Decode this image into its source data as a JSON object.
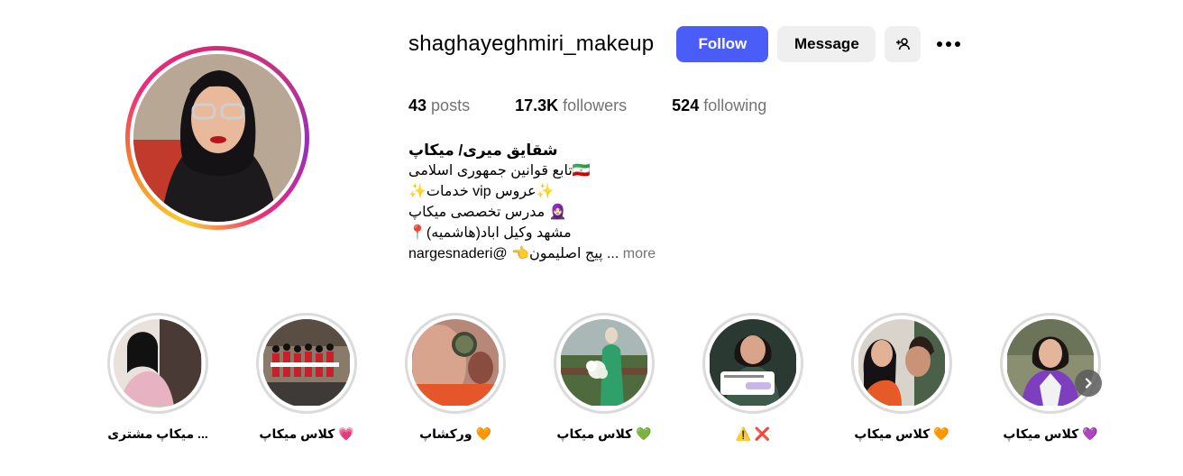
{
  "profile": {
    "username": "shaghayeghmiri_makeup",
    "follow_label": "Follow",
    "message_label": "Message",
    "icons": {
      "add_user": "add-user-icon",
      "more": "more-options-icon"
    },
    "accent": "#4a5df9"
  },
  "stats": {
    "posts_count": "43",
    "posts_label": "posts",
    "followers_count": "17.3K",
    "followers_label": "followers",
    "following_count": "524",
    "following_label": "following"
  },
  "bio": {
    "name": "شقایق میری/ میکاپ",
    "lines": [
      "تابع قوانین جمهوری اسلامی🇮🇷",
      "✨خدمات vip عروس✨",
      "مدرس تخصصی میکاپ 🧕🏻",
      "📍مشهد وکیل اباد(هاشمیه)",
      "nargesnaderi@ 👈پیج اصلیمون ..."
    ],
    "more_label": "more"
  },
  "highlights": [
    {
      "label": "میکاپ مشتری ..."
    },
    {
      "label": "کلاس میکاپ 💗"
    },
    {
      "label": "ورکشاپ 🧡"
    },
    {
      "label": "کلاس میکاپ 💚"
    },
    {
      "label": "⚠️ ❌"
    },
    {
      "label": "کلاس میکاپ 🧡"
    },
    {
      "label": "کلاس میکاپ 💜"
    }
  ]
}
